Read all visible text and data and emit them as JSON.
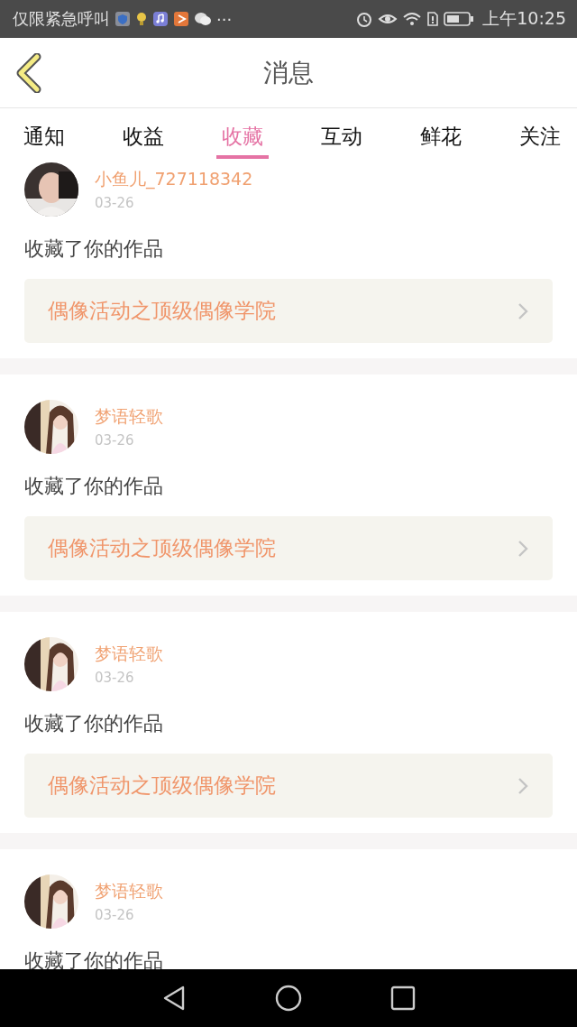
{
  "status_bar": {
    "notice": "仅限紧急呼叫",
    "more": "···",
    "time": "上午10:25"
  },
  "header": {
    "title": "消息"
  },
  "tabs": [
    {
      "label": "通知",
      "selected": false
    },
    {
      "label": "收益",
      "selected": false
    },
    {
      "label": "收藏",
      "selected": true
    },
    {
      "label": "互动",
      "selected": false
    },
    {
      "label": "鲜花",
      "selected": false
    },
    {
      "label": "关注",
      "selected": false
    }
  ],
  "messages": [
    {
      "user": "小鱼儿_727118342",
      "date": "03-26",
      "action": "收藏了你的作品",
      "work": "偶像活动之顶级偶像学院"
    },
    {
      "user": "梦语轻歌",
      "date": "03-26",
      "action": "收藏了你的作品",
      "work": "偶像活动之顶级偶像学院"
    },
    {
      "user": "梦语轻歌",
      "date": "03-26",
      "action": "收藏了你的作品",
      "work": "偶像活动之顶级偶像学院"
    },
    {
      "user": "梦语轻歌",
      "date": "03-26",
      "action": "收藏了你的作品"
    }
  ]
}
